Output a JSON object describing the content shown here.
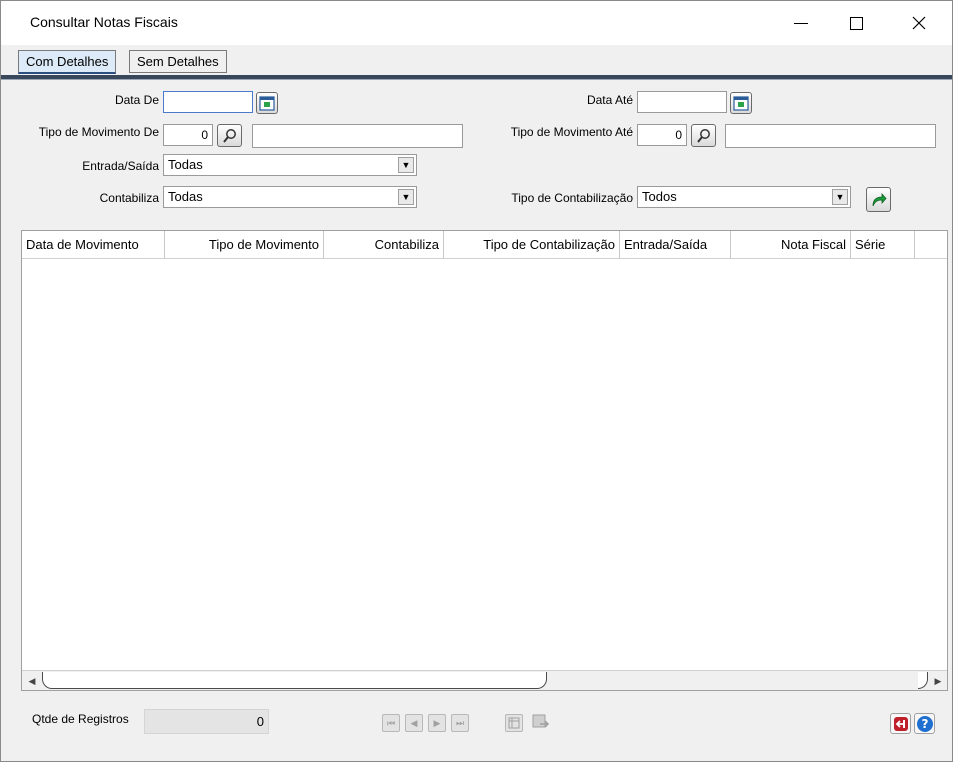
{
  "window": {
    "title": "Consultar Notas Fiscais",
    "controls": {
      "minimize": "—",
      "maximize": "□",
      "close": "✕"
    }
  },
  "tabs": [
    {
      "label": "Com Detalhes",
      "active": true
    },
    {
      "label": "Sem Detalhes",
      "active": false
    }
  ],
  "form": {
    "data_de": {
      "label": "Data De",
      "value": ""
    },
    "data_ate": {
      "label": "Data Até",
      "value": ""
    },
    "tipo_mov_de": {
      "label": "Tipo de Movimento De",
      "code": "0",
      "desc": ""
    },
    "tipo_mov_ate": {
      "label": "Tipo de Movimento Até",
      "code": "0",
      "desc": ""
    },
    "entrada_saida": {
      "label": "Entrada/Saída",
      "selected": "Todas"
    },
    "contabiliza": {
      "label": "Contabiliza",
      "selected": "Todas"
    },
    "tipo_contabilizacao": {
      "label": "Tipo de Contabilização",
      "selected": "Todos"
    }
  },
  "grid": {
    "columns": [
      "Data de Movimento",
      "Tipo de Movimento",
      "Contabiliza",
      "Tipo de Contabilização",
      "Entrada/Saída",
      "Nota Fiscal",
      "Série"
    ],
    "rows": []
  },
  "footer": {
    "count_label": "Qtde de Registros",
    "count_value": "0"
  },
  "colors": {
    "tab_active_bg": "#dcebf7",
    "tab_underline": "#39475a",
    "exit_icon": "#c0202a",
    "help_icon": "#1f6fd0",
    "refresh_icon": "#1d9b3a"
  },
  "icons": {
    "calendar": "calendar-icon",
    "search": "magnifier-icon",
    "refresh": "refresh-arrow-icon",
    "exit": "exit-icon",
    "help": "help-icon"
  }
}
